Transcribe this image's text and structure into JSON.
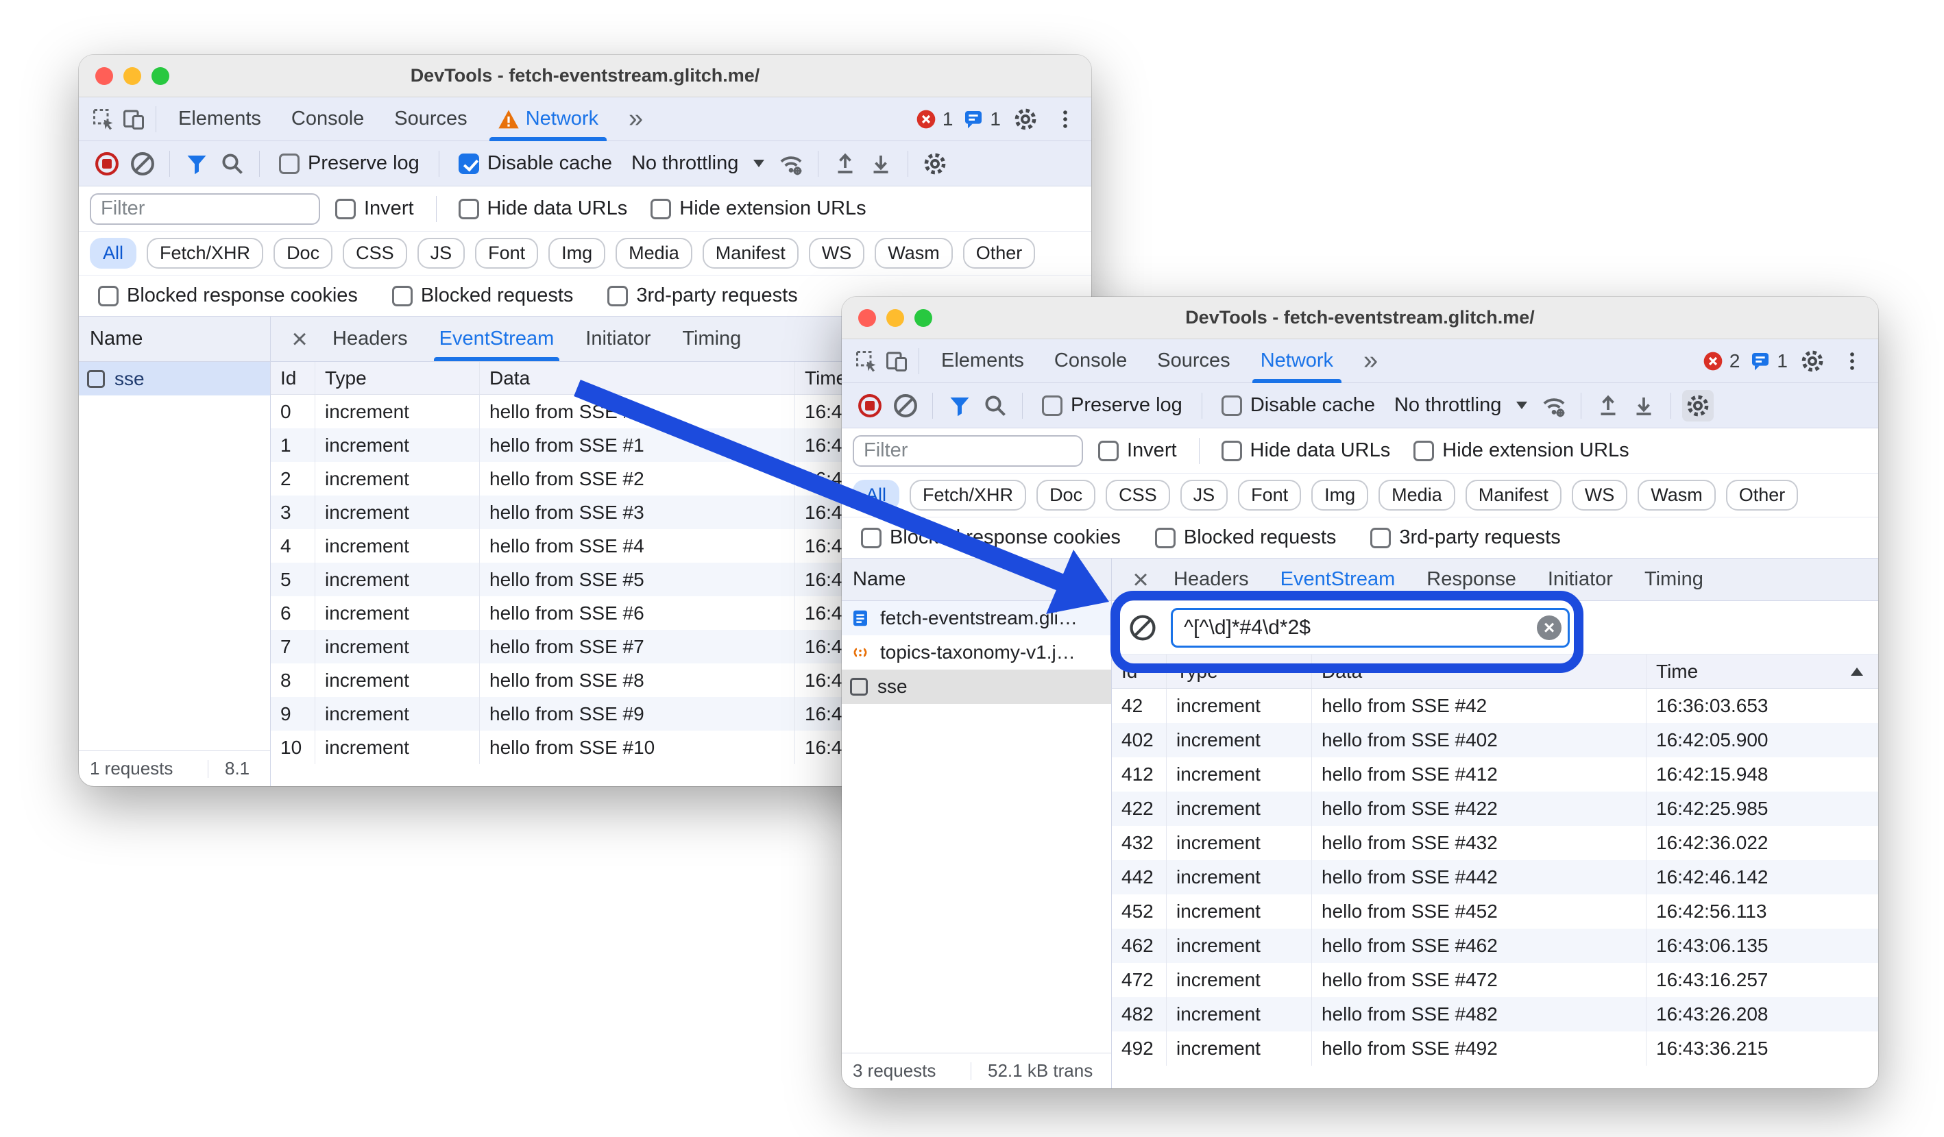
{
  "colors": {
    "accent": "#1a73e8",
    "callout_blue": "#1c4bdd",
    "error_red": "#d93025",
    "warning_orange": "#e8710a",
    "record_red": "#c5221f",
    "selected_row": "#d6e2f9",
    "chip_active_bg": "#d3e3fd",
    "chip_active_text": "#0b57d0"
  },
  "window1": {
    "title": "DevTools - fetch-eventstream.glitch.me/",
    "main_tabs": [
      "Elements",
      "Console",
      "Sources",
      "Network"
    ],
    "badges": {
      "errors": "1",
      "messages": "1"
    },
    "toolbar": {
      "preserve_log": "Preserve log",
      "disable_cache": "Disable cache",
      "throttling": "No throttling"
    },
    "filter_bar": {
      "placeholder": "Filter",
      "invert": "Invert",
      "hide_data_urls": "Hide data URLs",
      "hide_extension_urls": "Hide extension URLs"
    },
    "chips": [
      "All",
      "Fetch/XHR",
      "Doc",
      "CSS",
      "JS",
      "Font",
      "Img",
      "Media",
      "Manifest",
      "WS",
      "Wasm",
      "Other"
    ],
    "blocked": [
      "Blocked response cookies",
      "Blocked requests",
      "3rd-party requests"
    ],
    "sidebar": {
      "header": "Name",
      "items": [
        {
          "label": "sse"
        }
      ]
    },
    "detail_tabs": [
      "Headers",
      "EventStream",
      "Initiator",
      "Timing"
    ],
    "table": {
      "headers": [
        "Id",
        "Type",
        "Data",
        "Time"
      ],
      "rows": [
        {
          "id": "0",
          "type": "increment",
          "data": "hello from SSE #0",
          "time": "16:4"
        },
        {
          "id": "1",
          "type": "increment",
          "data": "hello from SSE #1",
          "time": "16:4"
        },
        {
          "id": "2",
          "type": "increment",
          "data": "hello from SSE #2",
          "time": "16:4"
        },
        {
          "id": "3",
          "type": "increment",
          "data": "hello from SSE #3",
          "time": "16:4"
        },
        {
          "id": "4",
          "type": "increment",
          "data": "hello from SSE #4",
          "time": "16:4"
        },
        {
          "id": "5",
          "type": "increment",
          "data": "hello from SSE #5",
          "time": "16:4"
        },
        {
          "id": "6",
          "type": "increment",
          "data": "hello from SSE #6",
          "time": "16:4"
        },
        {
          "id": "7",
          "type": "increment",
          "data": "hello from SSE #7",
          "time": "16:4"
        },
        {
          "id": "8",
          "type": "increment",
          "data": "hello from SSE #8",
          "time": "16:4"
        },
        {
          "id": "9",
          "type": "increment",
          "data": "hello from SSE #9",
          "time": "16:4"
        },
        {
          "id": "10",
          "type": "increment",
          "data": "hello from SSE #10",
          "time": "16:4"
        }
      ]
    },
    "status": {
      "requests": "1 requests",
      "size": "8.1"
    }
  },
  "window2": {
    "title": "DevTools - fetch-eventstream.glitch.me/",
    "main_tabs": [
      "Elements",
      "Console",
      "Sources",
      "Network"
    ],
    "badges": {
      "errors": "2",
      "messages": "1"
    },
    "toolbar": {
      "preserve_log": "Preserve log",
      "disable_cache": "Disable cache",
      "throttling": "No throttling"
    },
    "filter_bar": {
      "placeholder": "Filter",
      "invert": "Invert",
      "hide_data_urls": "Hide data URLs",
      "hide_extension_urls": "Hide extension URLs"
    },
    "chips": [
      "All",
      "Fetch/XHR",
      "Doc",
      "CSS",
      "JS",
      "Font",
      "Img",
      "Media",
      "Manifest",
      "WS",
      "Wasm",
      "Other"
    ],
    "blocked": [
      "Blocked response cookies",
      "Blocked requests",
      "3rd-party requests"
    ],
    "sidebar": {
      "header": "Name",
      "items": [
        {
          "label": "fetch-eventstream.gli…"
        },
        {
          "label": "topics-taxonomy-v1.j…"
        },
        {
          "label": "sse"
        }
      ]
    },
    "detail_tabs": [
      "Headers",
      "EventStream",
      "Response",
      "Initiator",
      "Timing"
    ],
    "stream_filter": {
      "value": "^[^\\d]*#4\\d*2$"
    },
    "table": {
      "headers": [
        "Id",
        "Type",
        "Data",
        "Time"
      ],
      "rows": [
        {
          "id": "42",
          "type": "increment",
          "data": "hello from SSE #42",
          "time": "16:36:03.653"
        },
        {
          "id": "402",
          "type": "increment",
          "data": "hello from SSE #402",
          "time": "16:42:05.900"
        },
        {
          "id": "412",
          "type": "increment",
          "data": "hello from SSE #412",
          "time": "16:42:15.948"
        },
        {
          "id": "422",
          "type": "increment",
          "data": "hello from SSE #422",
          "time": "16:42:25.985"
        },
        {
          "id": "432",
          "type": "increment",
          "data": "hello from SSE #432",
          "time": "16:42:36.022"
        },
        {
          "id": "442",
          "type": "increment",
          "data": "hello from SSE #442",
          "time": "16:42:46.142"
        },
        {
          "id": "452",
          "type": "increment",
          "data": "hello from SSE #452",
          "time": "16:42:56.113"
        },
        {
          "id": "462",
          "type": "increment",
          "data": "hello from SSE #462",
          "time": "16:43:06.135"
        },
        {
          "id": "472",
          "type": "increment",
          "data": "hello from SSE #472",
          "time": "16:43:16.257"
        },
        {
          "id": "482",
          "type": "increment",
          "data": "hello from SSE #482",
          "time": "16:43:26.208"
        },
        {
          "id": "492",
          "type": "increment",
          "data": "hello from SSE #492",
          "time": "16:43:36.215"
        }
      ]
    },
    "status": {
      "requests": "3 requests",
      "size": "52.1 kB trans"
    }
  }
}
